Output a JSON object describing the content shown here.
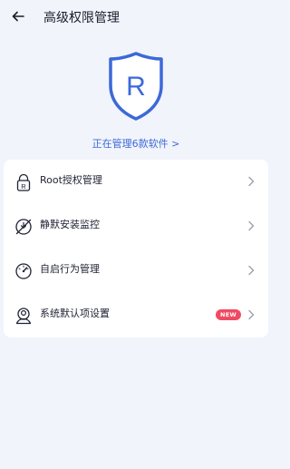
{
  "header": {
    "title": "高级权限管理",
    "back_icon": "back-arrow-icon"
  },
  "shield": {
    "letter": "R",
    "icon": "shield-icon",
    "stroke_color": "#3c69d9"
  },
  "manage_link": "正在管理6款软件 >",
  "menu": {
    "items": [
      {
        "label": "Root授权管理",
        "icon": "root-lock-icon"
      },
      {
        "label": "静默安装监控",
        "icon": "silent-install-icon"
      },
      {
        "label": "自启行为管理",
        "icon": "speedometer-icon"
      },
      {
        "label": "系统默认项设置",
        "icon": "user-settings-icon",
        "badge": "NEW"
      }
    ]
  },
  "colors": {
    "accent": "#3c69d9",
    "badge": "#f04a62",
    "background": "#f1f4fa"
  }
}
